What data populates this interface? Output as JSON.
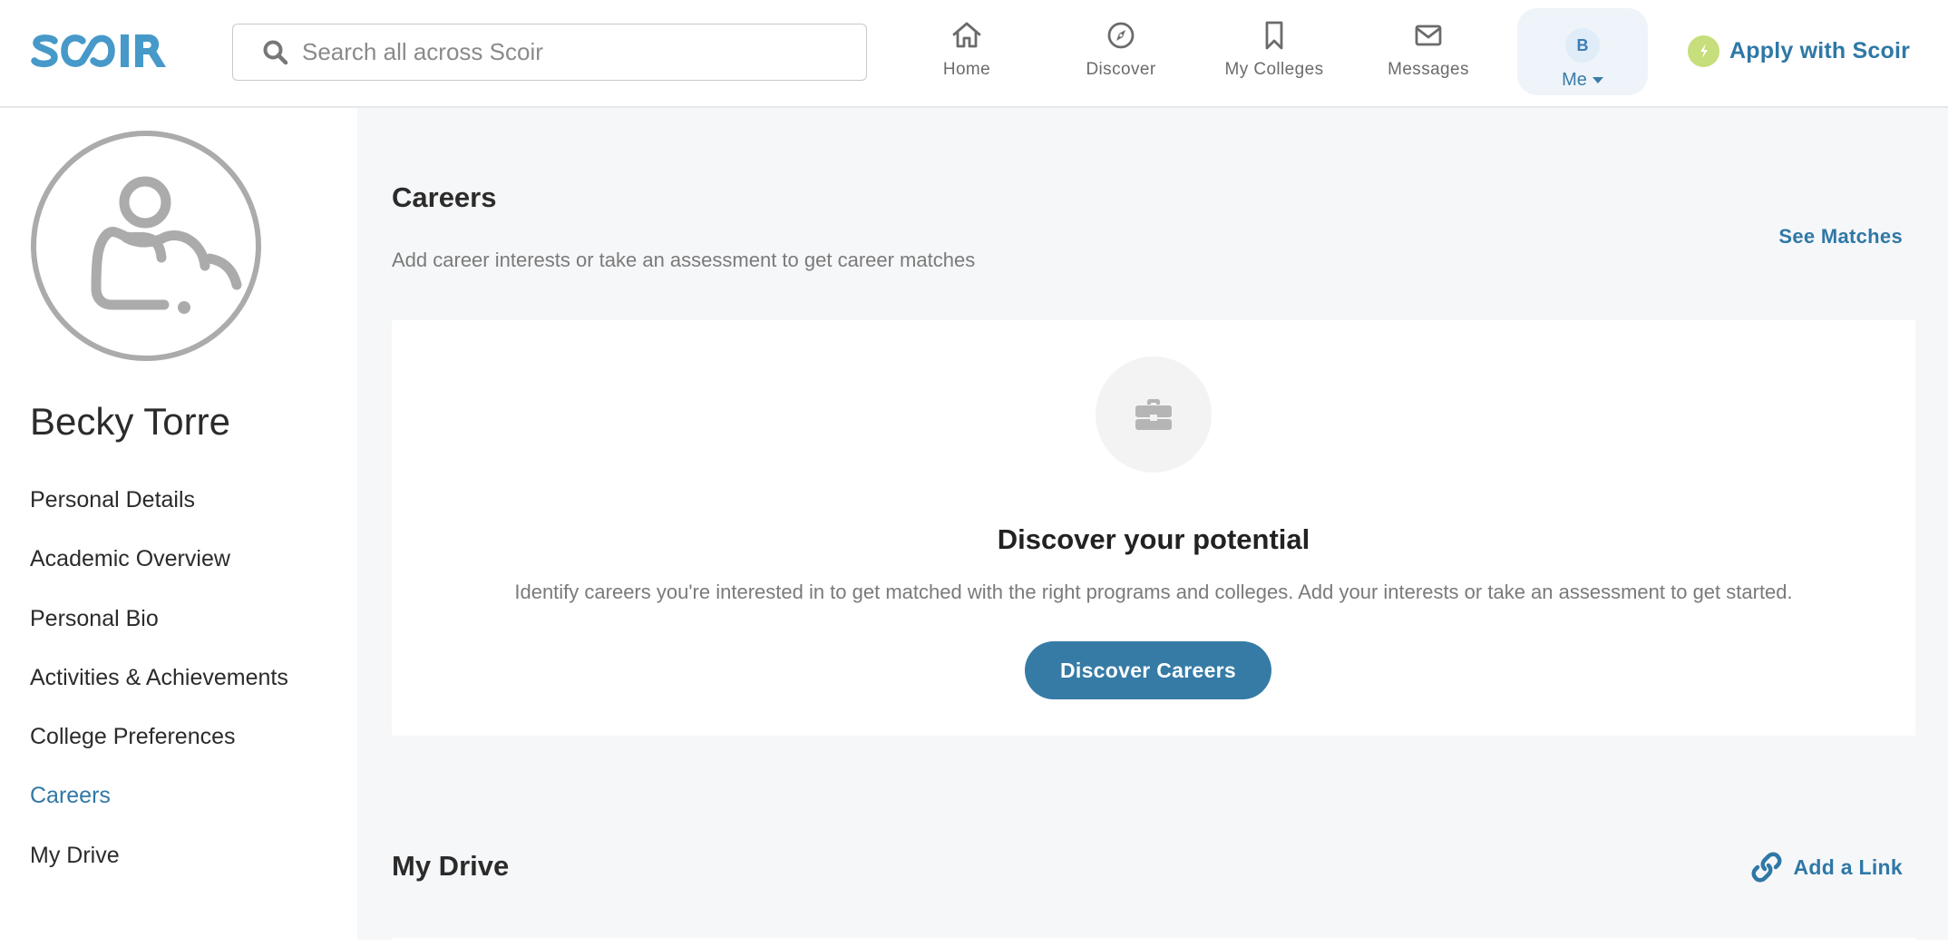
{
  "header": {
    "logo_text": "SCOIR",
    "search": {
      "placeholder": "Search all across Scoir",
      "value": ""
    },
    "nav": [
      {
        "label": "Home",
        "icon": "home-icon"
      },
      {
        "label": "Discover",
        "icon": "compass-icon"
      },
      {
        "label": "My Colleges",
        "icon": "bookmark-icon"
      },
      {
        "label": "Messages",
        "icon": "envelope-icon"
      }
    ],
    "me": {
      "initial": "B",
      "label": "Me"
    },
    "apply_label": "Apply with Scoir"
  },
  "sidebar": {
    "name": "Becky Torre",
    "items": [
      {
        "label": "Personal Details",
        "active": false
      },
      {
        "label": "Academic Overview",
        "active": false
      },
      {
        "label": "Personal Bio",
        "active": false
      },
      {
        "label": "Activities & Achievements",
        "active": false
      },
      {
        "label": "College Preferences",
        "active": false
      },
      {
        "label": "Careers",
        "active": true
      },
      {
        "label": "My Drive",
        "active": false
      }
    ]
  },
  "careers": {
    "title": "Careers",
    "subtitle": "Add career interests or take an assessment to get career matches",
    "see_matches_label": "See Matches",
    "empty_state": {
      "icon": "briefcase-icon",
      "heading": "Discover your potential",
      "description": "Identify careers you're interested in to get matched with the right programs and colleges. Add your interests or take an assessment to get started.",
      "button_label": "Discover Careers"
    }
  },
  "drive": {
    "title": "My Drive",
    "add_link_label": "Add a Link"
  },
  "colors": {
    "brand": "#4699c9",
    "accent": "#2f78a6",
    "button": "#367ba5",
    "apply_icon": "#c6de7b",
    "main_bg": "#f6f7f9"
  }
}
